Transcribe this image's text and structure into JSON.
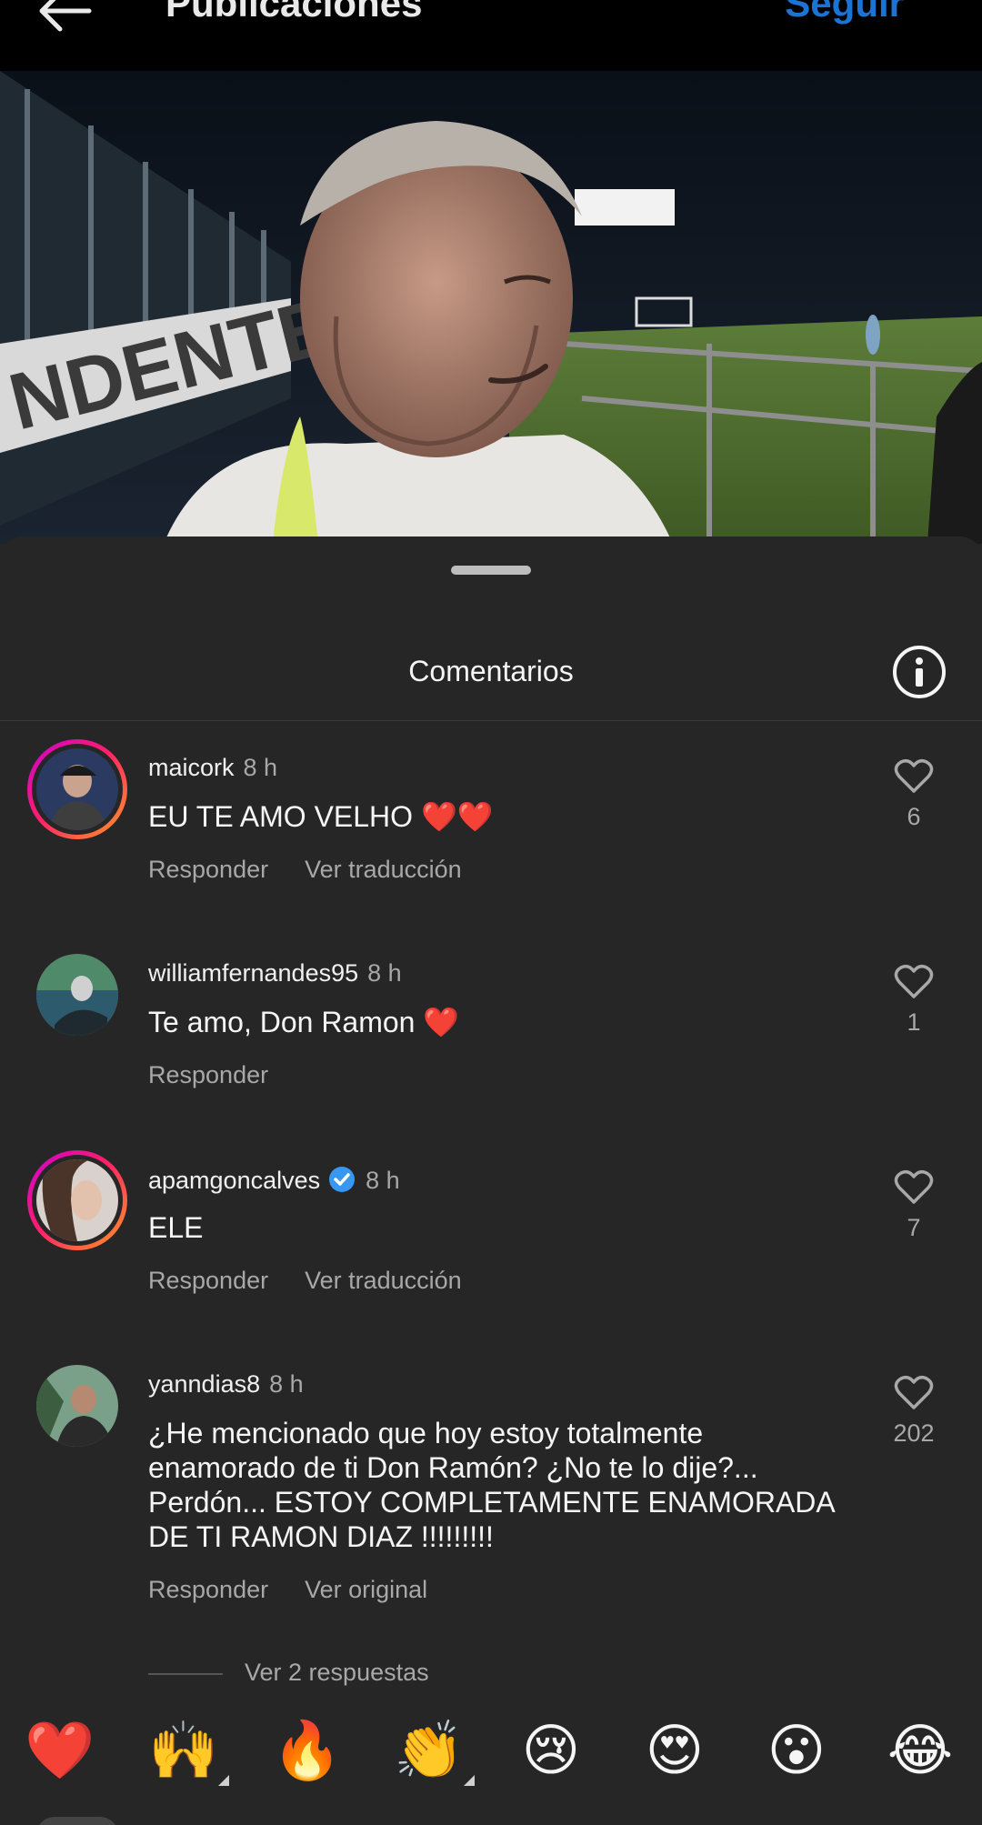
{
  "header": {
    "title": "Publicaciones",
    "follow_label": "Seguir"
  },
  "post": {
    "image_alt": "Hombre sonriendo en un campo de fútbol de noche"
  },
  "sheet": {
    "title": "Comentarios"
  },
  "comments": [
    {
      "username": "maicork",
      "time": "8 h",
      "text": "EU TE AMO VELHO ❤️❤️",
      "reply_label": "Responder",
      "translate_label": "Ver traducción",
      "likes": "6",
      "story_ring": true,
      "verified": false
    },
    {
      "username": "williamfernandes95",
      "time": "8 h",
      "text": "Te amo, Don Ramon ❤️",
      "reply_label": "Responder",
      "likes": "1",
      "story_ring": false,
      "verified": false
    },
    {
      "username": "apamgoncalves",
      "time": "8 h",
      "text": "ELE",
      "reply_label": "Responder",
      "translate_label": "Ver traducción",
      "likes": "7",
      "story_ring": true,
      "verified": true
    },
    {
      "username": "yanndias8",
      "time": "8 h",
      "text": "¿He mencionado que hoy estoy totalmente enamorado de ti Don Ramón? ¿No te lo dije?... Perdón... ESTOY COMPLETAMENTE ENAMORADA DE TI RAMON DIAZ !!!!!!!!!",
      "reply_label": "Responder",
      "translate_label": "Ver original",
      "likes": "202",
      "story_ring": false,
      "verified": false
    }
  ],
  "view_replies_label": "Ver 2 respuestas",
  "emoji_reactions": [
    "❤️",
    "🙌",
    "🔥",
    "👏",
    "😢",
    "😍",
    "😮",
    "😂"
  ],
  "colors": {
    "background": "#262626",
    "accent_blue": "#1b74d4",
    "secondary_text": "#a8a8a8"
  }
}
